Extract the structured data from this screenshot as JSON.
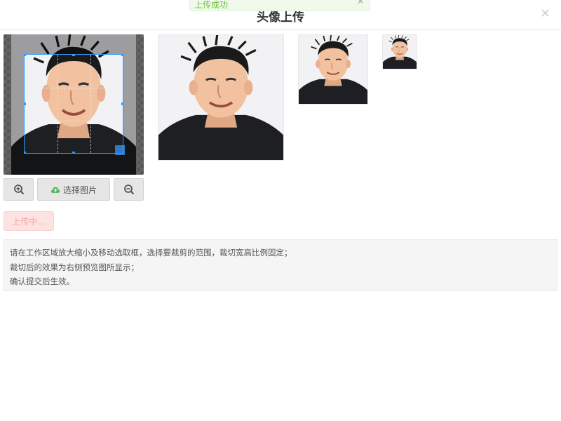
{
  "dialog": {
    "title": "头像上传",
    "close_icon": "close-icon"
  },
  "toast": {
    "message": "上传成功",
    "close_icon": "close-icon"
  },
  "cropper": {
    "photo": "portrait-photo",
    "zoom": 1
  },
  "buttons": {
    "zoom_in_icon": "zoom-in-icon",
    "select_label": "选择图片",
    "select_icon": "cloud-upload-icon",
    "zoom_out_icon": "zoom-out-icon",
    "upload_label": "上传中..."
  },
  "instructions": {
    "lines": [
      "请在工作区域放大缩小及移动选取框，选择要裁剪的范围，裁切宽高比例固定；",
      "裁切后的效果为右侧预览图所显示；",
      "确认提交后生效。"
    ]
  },
  "colors": {
    "accent": "#3399ff",
    "success": "#67c23a",
    "upload_bg": "#fde2e2",
    "upload_text": "#f3a6a6"
  }
}
